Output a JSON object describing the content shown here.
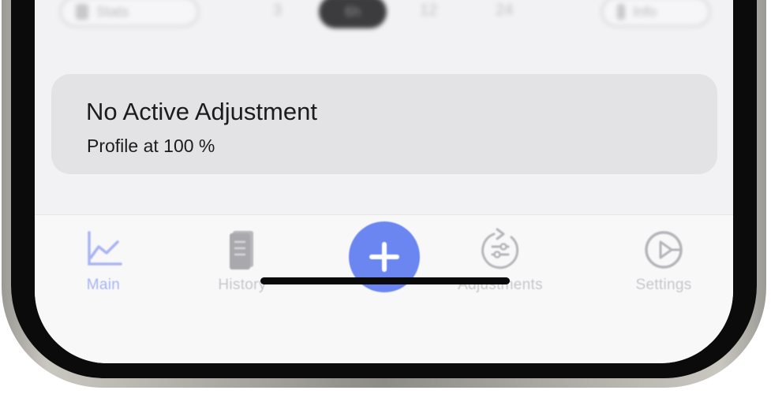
{
  "top_bar": {
    "left_button_label": "Stats",
    "range_options": [
      "3",
      "6h",
      "12",
      "24"
    ],
    "right_button_label": "Info"
  },
  "adjustment_card": {
    "title": "No Active Adjustment",
    "subtitle": "Profile at 100 %"
  },
  "tab_bar": {
    "main_label": "Main",
    "history_label": "History",
    "adjustments_label": "Adjustments",
    "settings_label": "Settings",
    "active_tab": "Main",
    "accent_color": "#6b86f0"
  }
}
